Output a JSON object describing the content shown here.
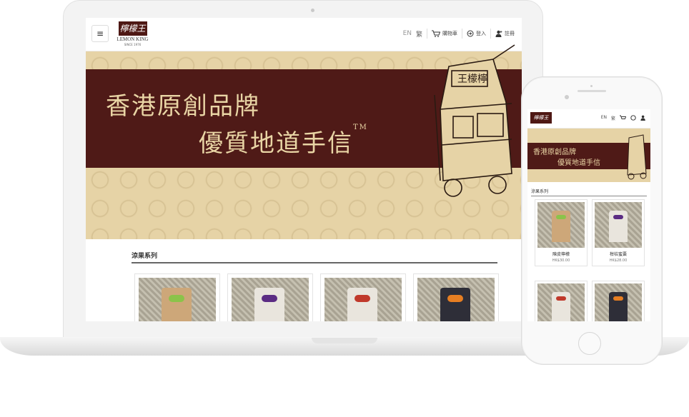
{
  "laptop": {
    "header": {
      "logo_mark": "檸檬王",
      "logo_name": "LEMON KING",
      "logo_since": "SINCE 1976",
      "lang_en": "EN",
      "lang_zh": "繁",
      "cart_label": "購物車",
      "login_label": "登入",
      "register_label": "註冊"
    },
    "banner": {
      "line1": "香港原創品牌",
      "line2": "優質地道手信",
      "tm": "TM"
    },
    "section_title": "涼果系列"
  },
  "phone": {
    "header": {
      "logo_mark": "檸檬王"
    },
    "banner": {
      "line1": "香港原創品牌",
      "line2": "優質地道手信"
    },
    "section_title": "涼果系列",
    "products": [
      {
        "name": "陳皮檸檬",
        "price": "HK$30.00"
      },
      {
        "name": "柑桔蜜棗",
        "price": "HK$28.00"
      }
    ]
  },
  "colors": {
    "brand_maroon": "#4f1a17",
    "banner_gold": "#e9d5a5",
    "banner_bg": "#e6d3a6"
  },
  "icons": [
    "menu-icon",
    "cart-icon",
    "login-icon",
    "user-icon"
  ]
}
